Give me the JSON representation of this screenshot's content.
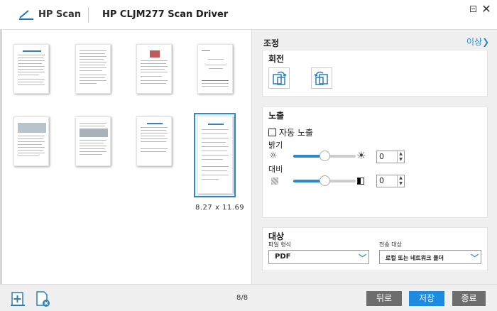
{
  "titlebar": {
    "app_name": "HP Scan",
    "driver_title": "HP CLJM277 Scan Driver",
    "minimize_label": "",
    "close_label": "✕"
  },
  "preview": {
    "page_size": "8.27 x 11.69"
  },
  "panel": {
    "adjust_label": "조정",
    "more_label": "이상",
    "rotate": {
      "title": "회전"
    },
    "exposure": {
      "title": "노출",
      "auto_label": "자동 노출",
      "auto_checked": false,
      "brightness_label": "밝기",
      "brightness_value": "0",
      "brightness_level": 0.5,
      "contrast_label": "대비",
      "contrast_value": "0",
      "contrast_level": 0.5
    },
    "target": {
      "title": "대상",
      "file_type_label": "파일 형식",
      "file_type_value": "PDF",
      "send_to_label": "전송 대상",
      "send_to_value": "로컬 또는 네트워크 폴더"
    }
  },
  "bottombar": {
    "page_count": "8/8",
    "back_label": "뒤로",
    "save_label": "저장",
    "close_label": "종료"
  },
  "colors": {
    "accent": "#2a8bd4",
    "save_button": "#1c8be0",
    "secondary_button": "#6d6d6d"
  }
}
